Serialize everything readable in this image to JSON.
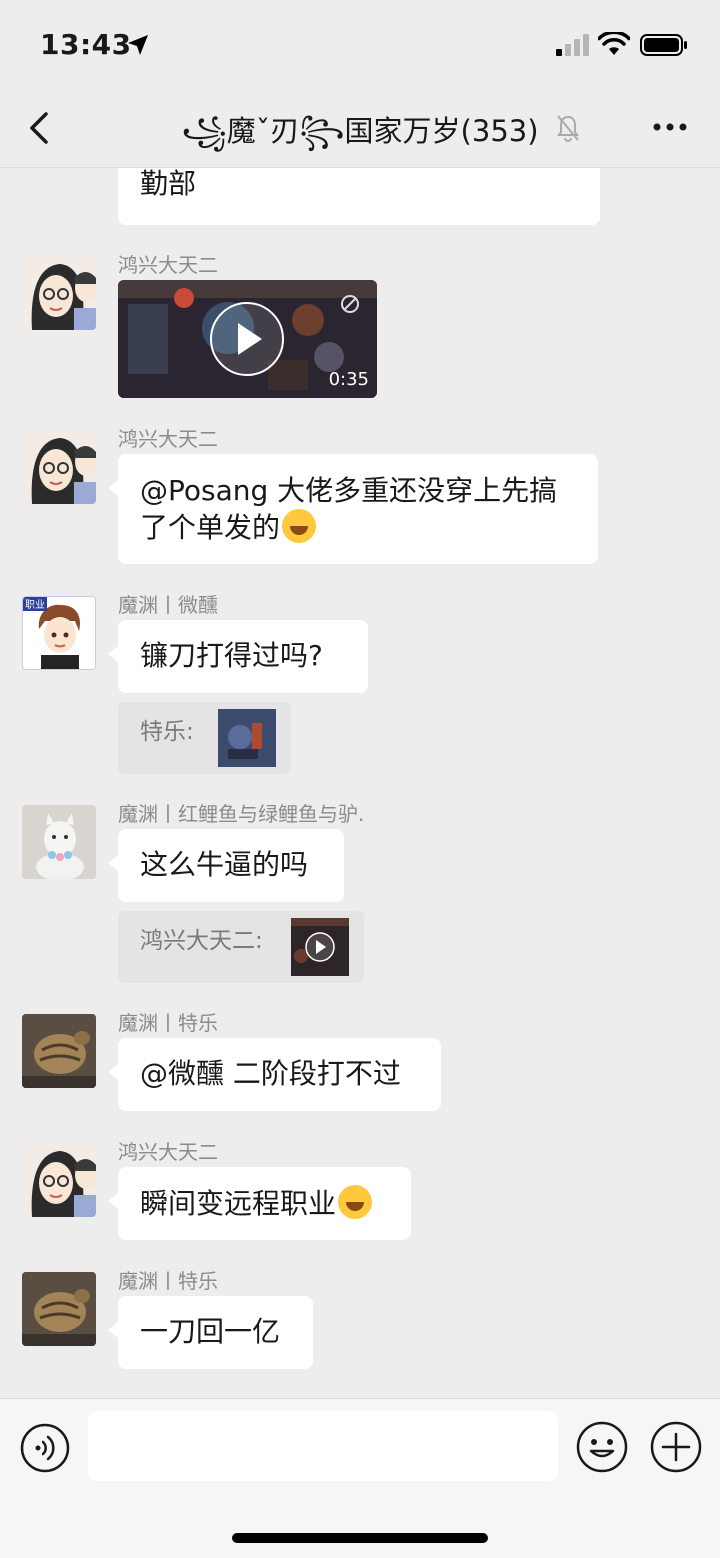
{
  "status": {
    "time": "13:43",
    "signal": "signal-icon",
    "wifi": "wifi-icon",
    "battery": "battery-icon"
  },
  "nav": {
    "title": "꧁魔ˇ刃꧂国家万岁(353)",
    "back_icon": "chevron-left-icon",
    "mute_icon": "bell-slash-icon",
    "more_icon": "more-dots-icon"
  },
  "messages": [
    {
      "type": "text",
      "text": "勤部"
    },
    {
      "type": "video",
      "sender": "鸿兴大天二",
      "duration": "0:35"
    },
    {
      "type": "text",
      "sender": "鸿兴大天二",
      "text_line1": "@Posang 大佬多重还没穿上先搞",
      "text_line2": "了个单发的"
    },
    {
      "type": "text",
      "sender": "魔渊丨微醺",
      "text": "镰刀打得过吗?",
      "quote": "特乐:"
    },
    {
      "type": "text",
      "sender": "魔渊丨红鲤鱼与绿鲤鱼与驴.",
      "text": "这么牛逼的吗",
      "quote": "鸿兴大天二:"
    },
    {
      "type": "text",
      "sender": "魔渊丨特乐",
      "text": "@微醺 二阶段打不过"
    },
    {
      "type": "text",
      "sender": "鸿兴大天二",
      "text": "瞬间变远程职业"
    },
    {
      "type": "text",
      "sender": "魔渊丨特乐",
      "text": "一刀回一亿"
    }
  ],
  "avatar_badge": "职业",
  "input_bar": {
    "voice_icon": "voice-icon",
    "emoji_icon": "emoji-icon",
    "plus_icon": "plus-icon"
  },
  "colors": {
    "background": "#ededed",
    "bubble": "#ffffff",
    "quote_bg": "#e4e4e4",
    "sender": "#8c8c8c"
  }
}
